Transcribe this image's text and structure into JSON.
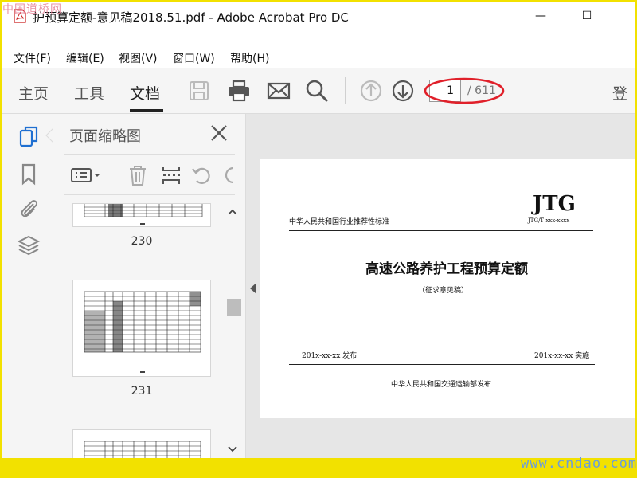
{
  "watermarks": {
    "top_left": "中国道桥网",
    "bottom_right": "www.cndao.com"
  },
  "window": {
    "title": "护预算定额-意见稿2018.51.pdf - Adobe Acrobat Pro DC",
    "minimize": "—",
    "maximize": "☐"
  },
  "menu": [
    "文件(F)",
    "编辑(E)",
    "视图(V)",
    "窗口(W)",
    "帮助(H)"
  ],
  "toolbar": {
    "tabs": [
      {
        "label": "主页",
        "active": false
      },
      {
        "label": "工具",
        "active": false
      },
      {
        "label": "文档",
        "active": true
      }
    ],
    "icons": [
      "save-icon",
      "print-icon",
      "email-icon",
      "search-icon",
      "page-up-icon",
      "page-down-icon"
    ],
    "page_current": "1",
    "page_total": "/ 611",
    "signin": "登"
  },
  "rail_icons": [
    "page-thumbnails-icon",
    "bookmark-icon",
    "attachment-icon",
    "layers-icon"
  ],
  "thumbnail_panel": {
    "title": "页面缩略图",
    "tools": [
      "options-menu-icon",
      "delete-icon",
      "insert-page-icon",
      "undo-icon"
    ],
    "pages": [
      {
        "label": "230"
      },
      {
        "label": "231"
      },
      {
        "label": ""
      }
    ]
  },
  "document_page": {
    "top_left": "中华人民共和国行业推荐性标准",
    "logo": "JTG",
    "code": "JTG/T xxx-xxxx",
    "title": "高速公路养护工程预算定额",
    "subtitle": "（征求意见稿）",
    "publish_date": "201x-xx-xx 发布",
    "implement_date": "201x-xx-xx 实施",
    "publisher": "中华人民共和国交通运输部发布"
  },
  "colors": {
    "accent_ellipse": "#e0202a",
    "frame": "#f2e100"
  }
}
